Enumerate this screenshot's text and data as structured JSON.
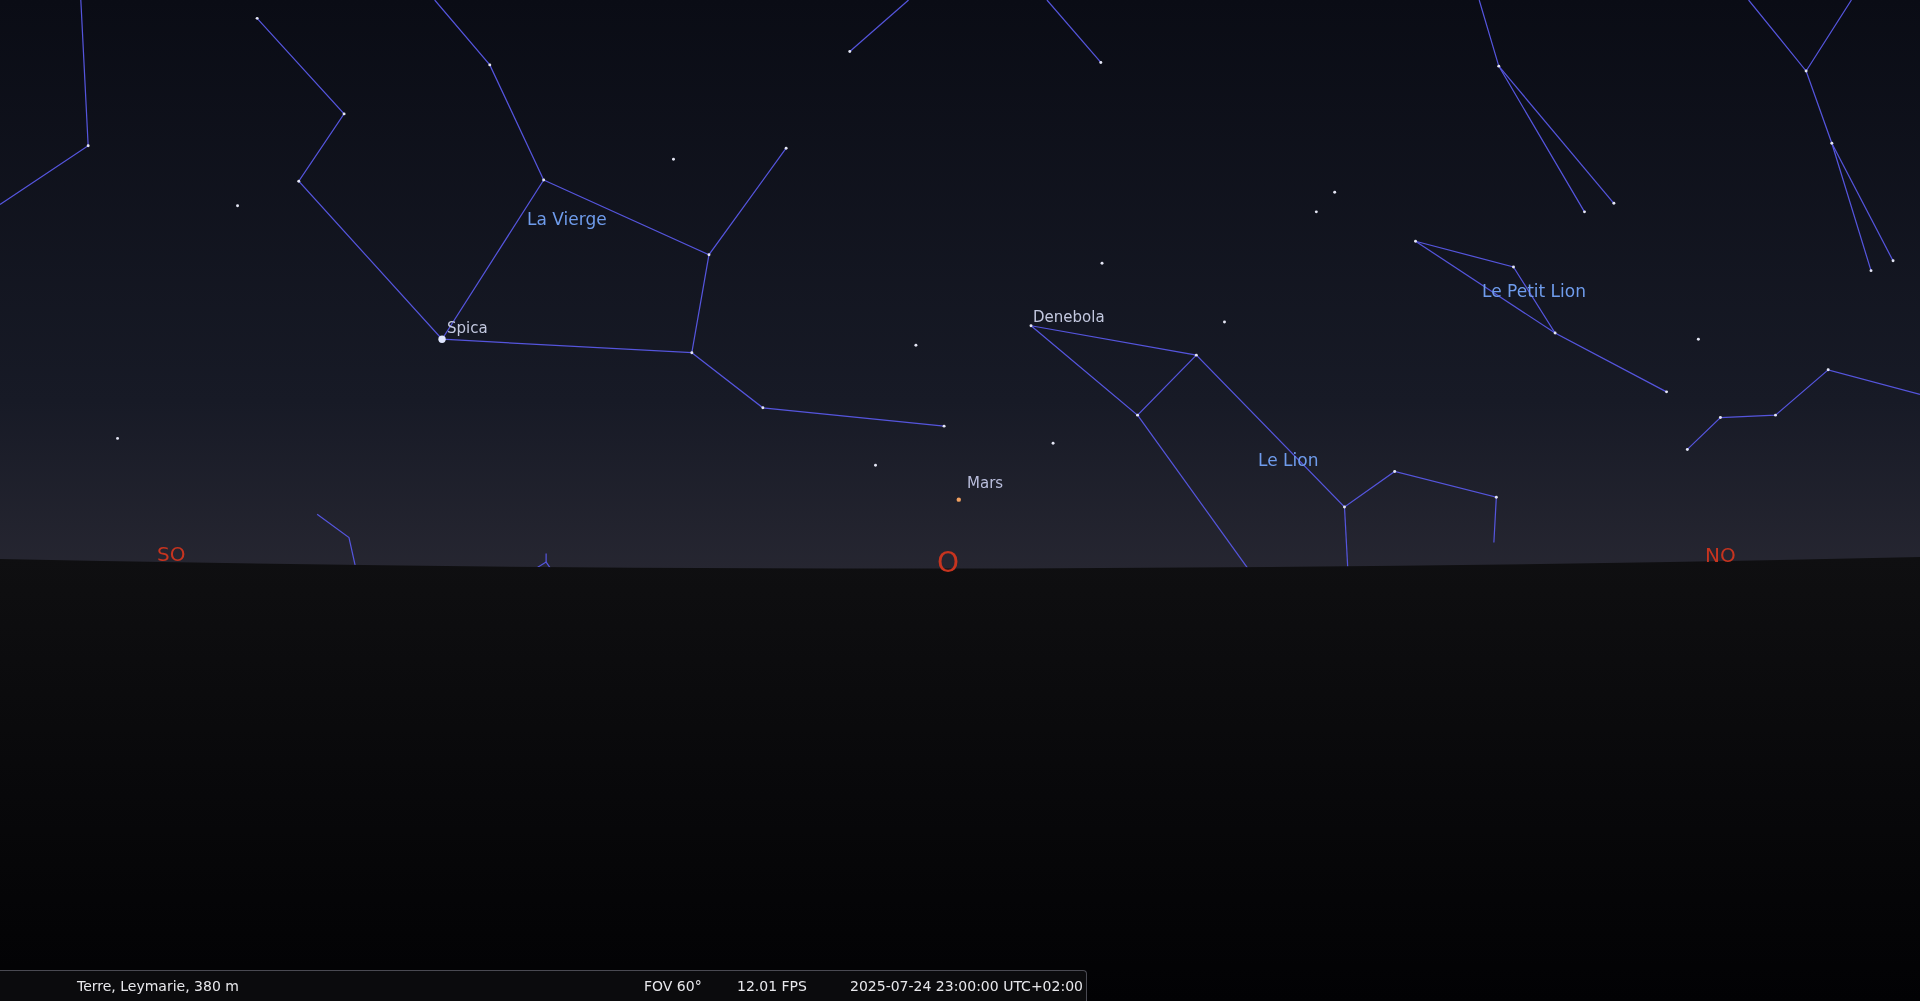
{
  "sky_labels": [
    {
      "kind": "constellation",
      "text": "La Vierge"
    },
    {
      "kind": "star",
      "text": "Spica"
    },
    {
      "kind": "star",
      "text": "Denebola"
    },
    {
      "kind": "planet",
      "text": "Mars"
    },
    {
      "kind": "constellation",
      "text": "Le Lion"
    },
    {
      "kind": "constellation",
      "text": "Le Petit Lion"
    },
    {
      "kind": "intercardinal",
      "text": "SO"
    },
    {
      "kind": "cardinal",
      "text": "O"
    },
    {
      "kind": "intercardinal",
      "text": "NO"
    }
  ],
  "status_bar": {
    "location": "Terre, Leymarie, 380 m",
    "fov": "FOV 60°",
    "fps": "12.01 FPS",
    "datetime": "2025-07-24 23:00:00 UTC+02:00"
  }
}
